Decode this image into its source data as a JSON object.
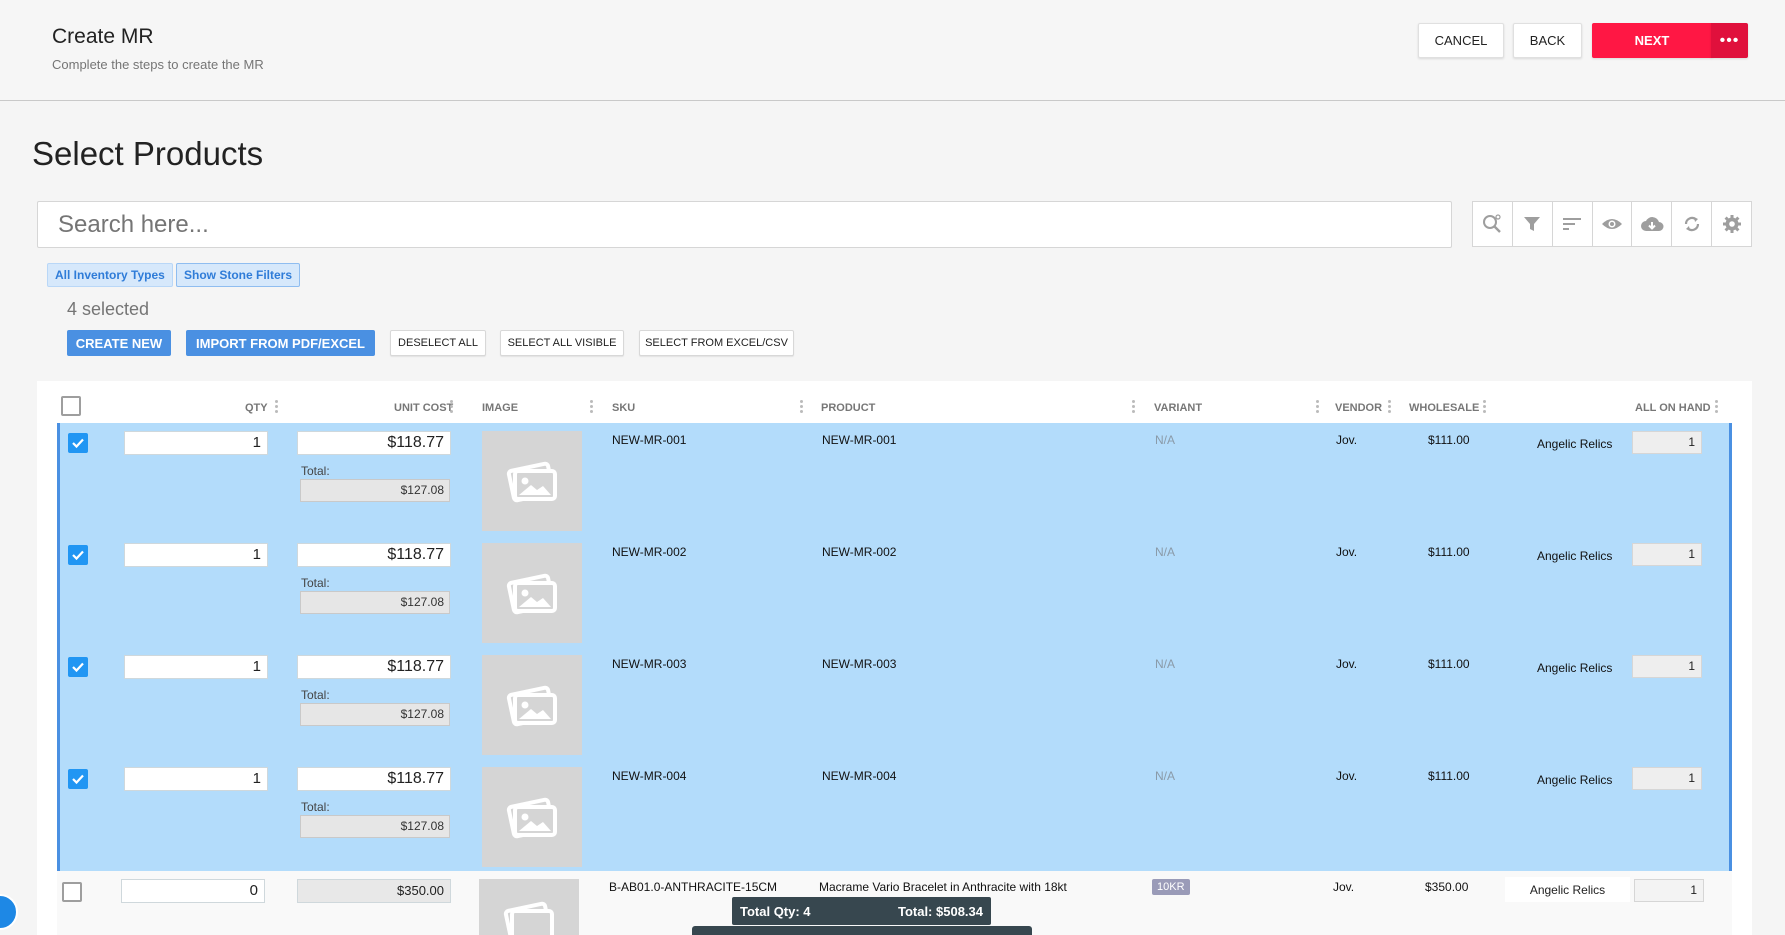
{
  "header": {
    "title": "Create MR",
    "subtitle": "Complete the steps to create the MR",
    "cancel_label": "CANCEL",
    "back_label": "BACK",
    "next_label": "NEXT",
    "more_label": "•••"
  },
  "page_title": "Select Products",
  "search": {
    "placeholder": "Search here..."
  },
  "toolbar": [
    "search-settings-icon",
    "filter-icon",
    "sort-icon",
    "eye-icon",
    "cloud-download-icon",
    "refresh-icon",
    "gear-icon"
  ],
  "filters": {
    "inventory_types": "All Inventory Types",
    "stone_filters": "Show Stone Filters"
  },
  "selected_count": "4 selected",
  "actions": {
    "create_new": "CREATE NEW",
    "import": "IMPORT FROM PDF/EXCEL",
    "deselect_all": "DESELECT ALL",
    "select_all_visible": "SELECT ALL VISIBLE",
    "select_from_excel": "SELECT FROM EXCEL/CSV"
  },
  "columns": {
    "qty": "QTY",
    "unit_cost": "UNIT COST",
    "image": "IMAGE",
    "sku": "SKU",
    "product": "PRODUCT",
    "variant": "VARIANT",
    "vendor": "VENDOR",
    "wholesale": "WHOLESALE",
    "all_on_hand": "ALL ON HAND"
  },
  "total_label": "Total:",
  "rows": [
    {
      "qty": "1",
      "unit_cost": "$118.77",
      "total": "$127.08",
      "sku": "NEW-MR-001",
      "product": "NEW-MR-001",
      "variant": "N/A",
      "vendor": "Jov.",
      "wholesale": "$111.00",
      "store": "Angelic Relics",
      "on_hand": "1"
    },
    {
      "qty": "1",
      "unit_cost": "$118.77",
      "total": "$127.08",
      "sku": "NEW-MR-002",
      "product": "NEW-MR-002",
      "variant": "N/A",
      "vendor": "Jov.",
      "wholesale": "$111.00",
      "store": "Angelic Relics",
      "on_hand": "1"
    },
    {
      "qty": "1",
      "unit_cost": "$118.77",
      "total": "$127.08",
      "sku": "NEW-MR-003",
      "product": "NEW-MR-003",
      "variant": "N/A",
      "vendor": "Jov.",
      "wholesale": "$111.00",
      "store": "Angelic Relics",
      "on_hand": "1"
    },
    {
      "qty": "1",
      "unit_cost": "$118.77",
      "total": "$127.08",
      "sku": "NEW-MR-004",
      "product": "NEW-MR-004",
      "variant": "N/A",
      "vendor": "Jov.",
      "wholesale": "$111.00",
      "store": "Angelic Relics",
      "on_hand": "1"
    }
  ],
  "unselected_row": {
    "qty": "0",
    "unit_cost": "$350.00",
    "sku": "B-AB01.0-ANTHRACITE-15CM",
    "product": "Macrame Vario Bracelet in Anthracite with 18kt",
    "variant": "10KR",
    "vendor": "Jov.",
    "wholesale": "$350.00",
    "store": "Angelic Relics",
    "on_hand": "1"
  },
  "summary": {
    "total_qty": "Total Qty: 4",
    "total": "Total: $508.34"
  },
  "colors": {
    "accent": "#ff1744",
    "primary": "#4a90e2",
    "selected_row": "#b3dcfb"
  }
}
